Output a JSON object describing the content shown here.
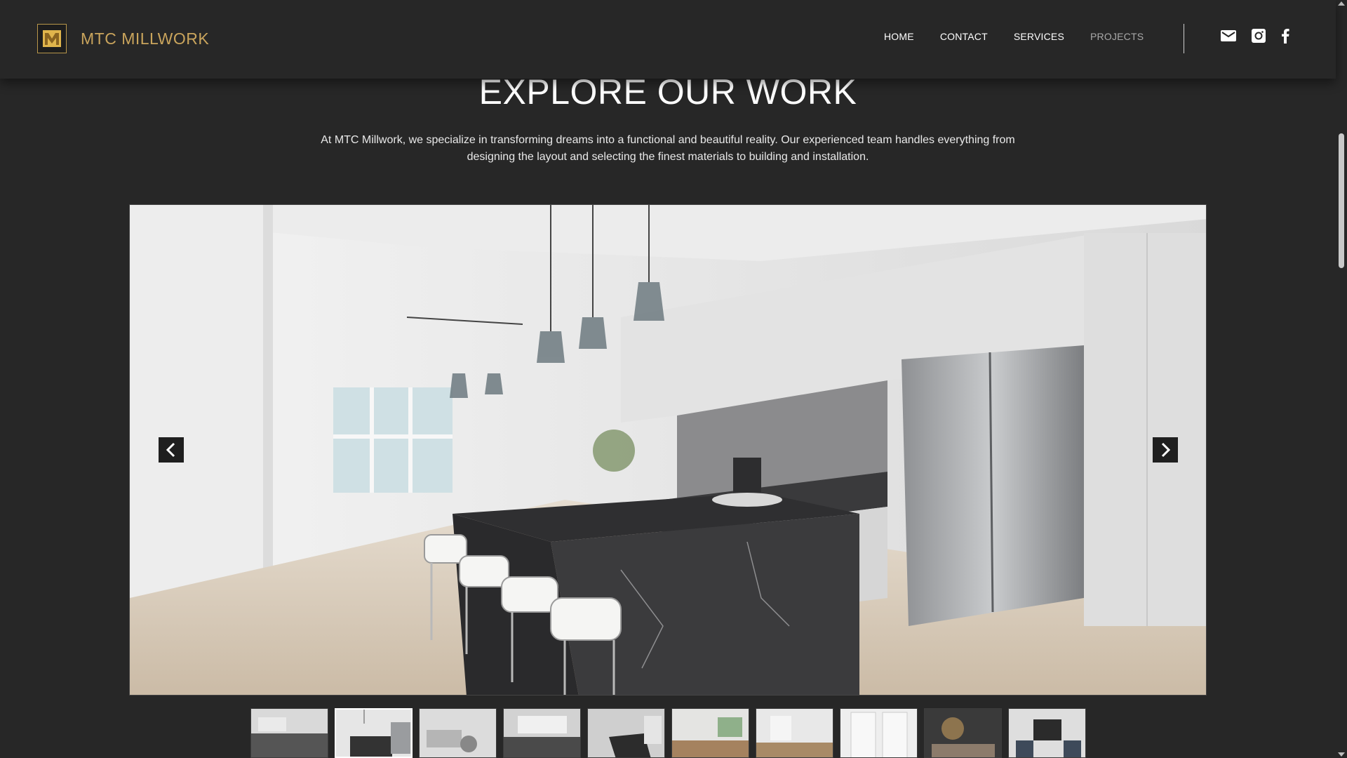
{
  "brand": {
    "name": "MTC MILLWORK",
    "logo_letter": "M",
    "logo_color": "#c9a45c"
  },
  "nav": {
    "items": [
      {
        "label": "HOME"
      },
      {
        "label": "CONTACT"
      },
      {
        "label": "SERVICES"
      },
      {
        "label": "PROJECTS",
        "active": true
      }
    ]
  },
  "social": {
    "icons": [
      "mail-icon",
      "instagram-icon",
      "facebook-icon"
    ]
  },
  "page": {
    "title": "EXPLORE OUR WORK",
    "intro": "At MTC Millwork, we specialize in transforming dreams into a functional and beautiful reality. Our experienced team handles everything from designing the layout and selecting the finest materials to building and installation."
  },
  "gallery": {
    "selected_index": 1,
    "thumbnail_count": 10,
    "prev_icon": "chevron-left-icon",
    "next_icon": "chevron-right-icon"
  },
  "colors": {
    "background": "#272727",
    "accent_gold": "#c9a45c",
    "nav_active": "#a9a9a9"
  }
}
